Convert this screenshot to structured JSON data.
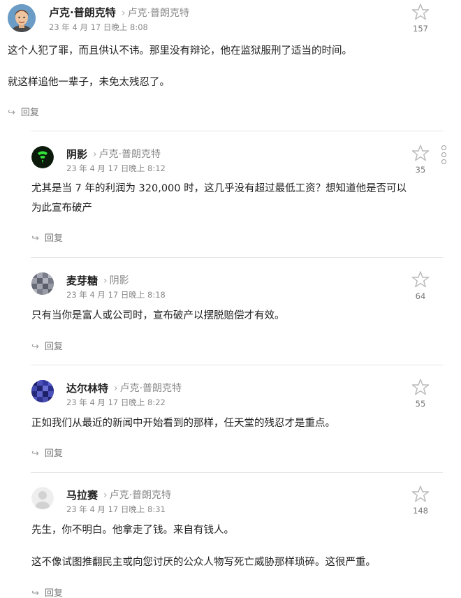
{
  "comments": [
    {
      "author": "卢克·普朗克特",
      "reply_to": "卢克·普朗克特",
      "time": "23 年 4 月 17 日晚上 8:08",
      "votes": "157",
      "lines": [
        "这个人犯了罪，而且供认不讳。那里没有辩论，他在监狱服刑了适当的时间。",
        "就这样追他一辈子，未免太残忍了。"
      ],
      "reply_label": "回复"
    },
    {
      "author": "阴影",
      "reply_to": "卢克·普朗克特",
      "time": "23 年 4 月 17 日晚上 8:12",
      "votes": "35",
      "lines": [
        "尤其是当 7 年的利润为 320,000 时，这几乎没有超过最低工资？想知道他是否可以",
        "为此宣布破产"
      ],
      "reply_label": "回复"
    },
    {
      "author": "麦芽糖",
      "reply_to": "阴影",
      "time": "23 年 4 月 17 日晚上 8:18",
      "votes": "64",
      "lines": [
        "只有当你是富人或公司时，宣布破产以摆脱赔偿才有效。"
      ],
      "reply_label": "回复"
    },
    {
      "author": "达尔林特",
      "reply_to": "卢克·普朗克特",
      "time": "23 年 4 月 17 日晚上 8:22",
      "votes": "55",
      "lines": [
        "正如我们从最近的新闻中开始看到的那样，任天堂的残忍才是重点。"
      ],
      "reply_label": "回复"
    },
    {
      "author": "马拉赛",
      "reply_to": "卢克·普朗克特",
      "time": "23 年 4 月 17 日晚上 8:31",
      "votes": "148",
      "lines": [
        "先生，你不明白。他拿走了钱。来自有钱人。",
        "这不像试图推翻民主或向您讨厌的公众人物写死亡威胁那样琐碎。这很严重。"
      ],
      "reply_label": "回复"
    }
  ]
}
